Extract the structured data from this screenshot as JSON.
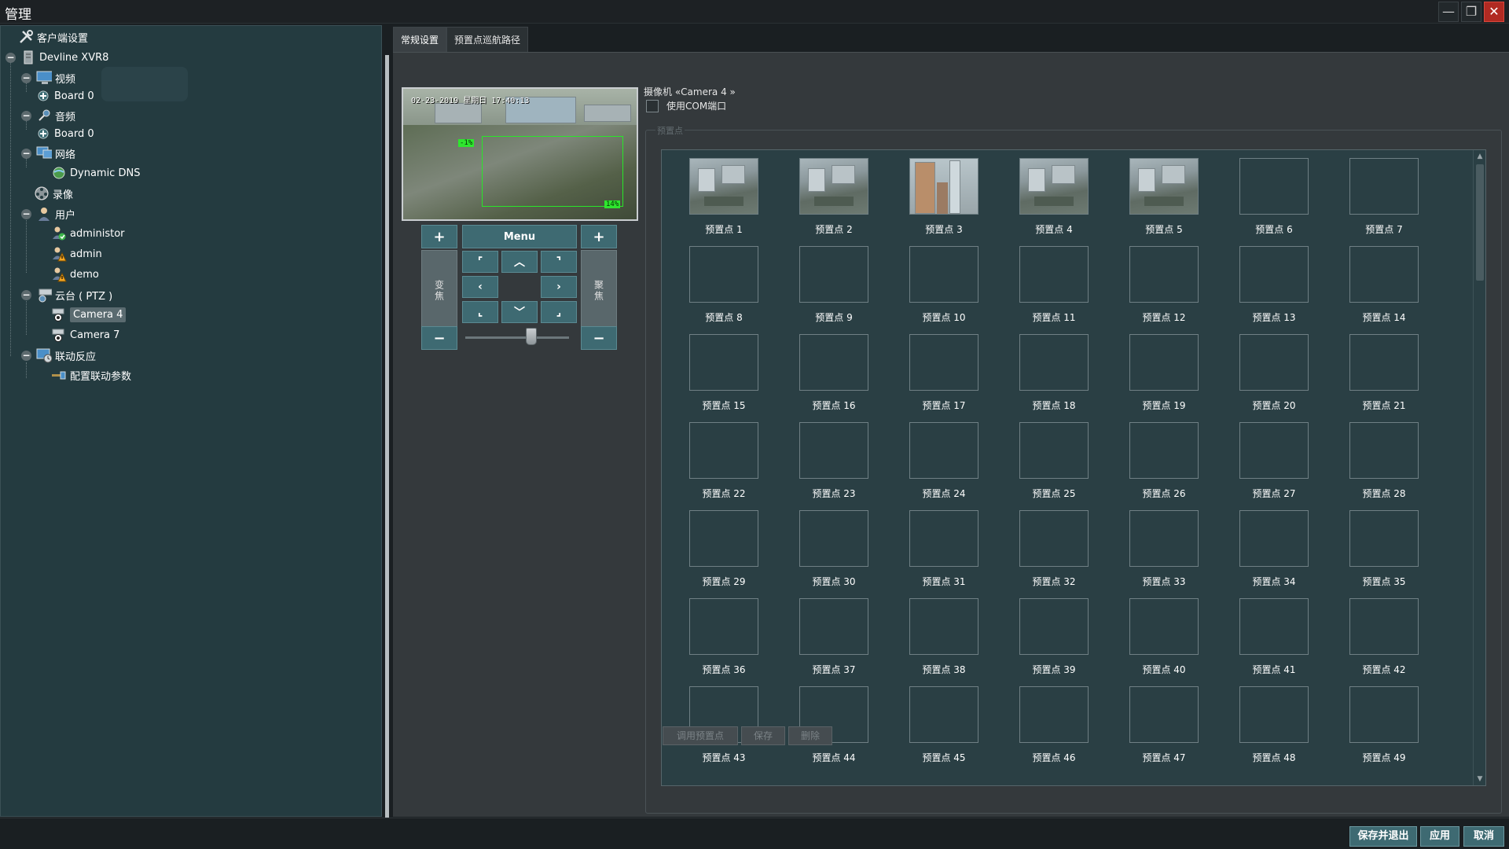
{
  "window": {
    "title": "管理",
    "minimize_glyph": "—",
    "maximize_glyph": "❐",
    "close_glyph": "✕"
  },
  "tree": {
    "items": [
      {
        "label": "客户端设置",
        "icon": "tools-icon"
      },
      {
        "label": "Devline XVR8",
        "icon": "server-icon"
      },
      {
        "label": "视频",
        "icon": "monitor-icon"
      },
      {
        "label": "Board 0",
        "icon": "board-icon"
      },
      {
        "label": "音频",
        "icon": "microphone-icon"
      },
      {
        "label": "Board 0",
        "icon": "board-icon"
      },
      {
        "label": "网络",
        "icon": "network-icon"
      },
      {
        "label": "Dynamic DNS",
        "icon": "globe-icon"
      },
      {
        "label": "录像",
        "icon": "film-reel-icon"
      },
      {
        "label": "用户",
        "icon": "users-icon"
      },
      {
        "label": "administor",
        "icon": "user-ok-icon"
      },
      {
        "label": "admin",
        "icon": "user-warning-icon"
      },
      {
        "label": "demo",
        "icon": "user-warning-icon"
      },
      {
        "label": "云台 ( PTZ )",
        "icon": "ptz-camera-icon"
      },
      {
        "label": "Camera 4",
        "icon": "camera-icon"
      },
      {
        "label": "Camera 7",
        "icon": "camera-icon"
      },
      {
        "label": "联动反应",
        "icon": "reaction-icon"
      },
      {
        "label": "配置联动参数",
        "icon": "settings-link-icon"
      }
    ]
  },
  "tabs": [
    {
      "label": "常规设置"
    },
    {
      "label": "预置点巡航路径"
    }
  ],
  "preview": {
    "timestamp": "02-23-2019 星期日 17:40:13",
    "zone_left_label": "-1%",
    "zone_right_label": "14%"
  },
  "ptz": {
    "plus": "+",
    "minus": "−",
    "menu_label": "Menu",
    "zoom_label": "变焦",
    "focus_label": "聚焦",
    "arrows": {
      "up_left": "⌜",
      "up": "︿",
      "up_right": "⌝",
      "left": "‹",
      "right": "›",
      "down_left": "⌞",
      "down": "﹀",
      "down_right": "⌟"
    },
    "slider_position": 0.5
  },
  "camera": {
    "label": "摄像机 «Camera 4 »",
    "use_com_label": "使用COM端口",
    "use_com_checked": false
  },
  "presets": {
    "group_label": "预置点",
    "items": [
      "预置点 1",
      "预置点 2",
      "预置点 3",
      "预置点 4",
      "预置点 5",
      "预置点 6",
      "预置点 7",
      "预置点 8",
      "预置点 9",
      "预置点 10",
      "预置点 11",
      "预置点 12",
      "预置点 13",
      "预置点 14",
      "预置点 15",
      "预置点 16",
      "预置点 17",
      "预置点 18",
      "预置点 19",
      "预置点 20",
      "预置点 21",
      "预置点 22",
      "预置点 23",
      "预置点 24",
      "预置点 25",
      "预置点 26",
      "预置点 27",
      "预置点 28",
      "预置点 29",
      "预置点 30",
      "预置点 31",
      "预置点 32",
      "预置点 33",
      "预置点 34",
      "预置点 35",
      "预置点 36",
      "预置点 37",
      "预置点 38",
      "预置点 39",
      "预置点 40",
      "预置点 41",
      "预置点 42",
      "预置点 43",
      "预置点 44",
      "预置点 45",
      "预置点 46",
      "预置点 47",
      "预置点 48",
      "预置点 49"
    ],
    "images_on": [
      1,
      2,
      3,
      4,
      5
    ],
    "scroll_up_glyph": "▲",
    "scroll_down_glyph": "▼",
    "buttons": {
      "call": "调用预置点",
      "save": "保存",
      "delete": "删除"
    }
  },
  "footer": {
    "save_exit": "保存并退出",
    "apply": "应用",
    "cancel": "取消"
  },
  "colors": {
    "accent_button": "#3e6a72",
    "panel_bg": "#243b40",
    "grid_bg": "#2a3f44",
    "close_red": "#b12a22"
  }
}
